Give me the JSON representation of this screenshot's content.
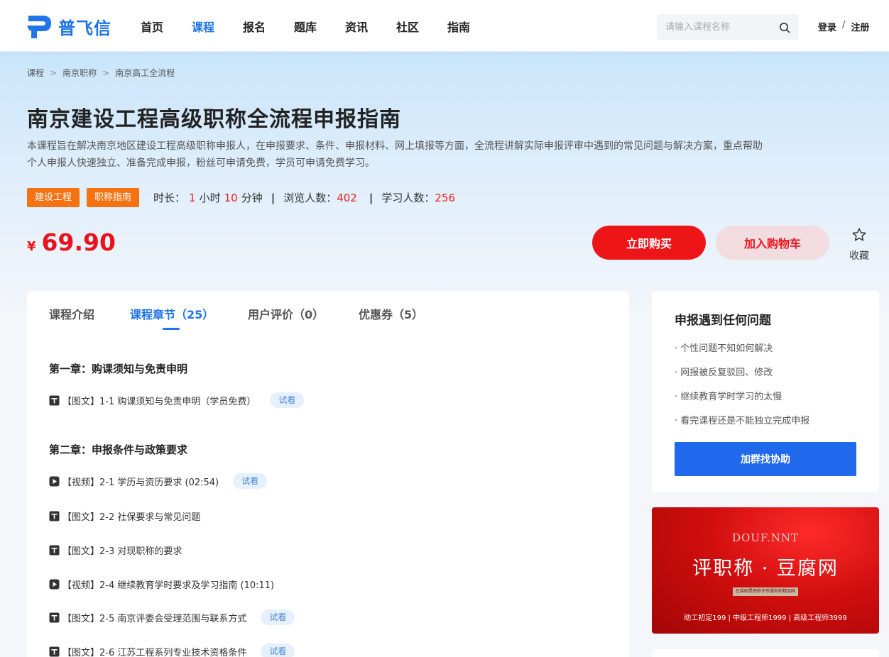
{
  "header": {
    "brand": "普飞信",
    "nav": [
      "首页",
      "课程",
      "报名",
      "题库",
      "资讯",
      "社区",
      "指南"
    ],
    "active_nav": "课程",
    "search_placeholder": "请输入课程名称",
    "login": "登录",
    "separator": "/",
    "register": "注册",
    "brand_color": "#1f74e8"
  },
  "breadcrumb": [
    "课程",
    "南京职称",
    "南京高工全流程"
  ],
  "course": {
    "title": "南京建设工程高级职称全流程申报指南",
    "description": "本课程旨在解决南京地区建设工程高级职称申报人，在申报要求、条件、申报材料、网上填报等方面，全流程讲解实际申报评审中遇到的常见问题与解决方案，重点帮助个人申报人快速独立、准备完成申报，粉丝可申请免费，学员可申请免费学习。",
    "tags": [
      "建设工程",
      "职称指南"
    ],
    "duration_label": "时长：",
    "duration_hours": "1",
    "hours_unit": "小时",
    "duration_minutes": "10",
    "minutes_unit": "分钟",
    "views_label": "浏览人数：",
    "views": "402",
    "learners_label": "学习人数：",
    "learners": "256",
    "currency": "¥",
    "price": "69.90",
    "buy_label": "立即购买",
    "cart_label": "加入购物车",
    "favorite_label": "收藏"
  },
  "tabs": [
    "课程介绍",
    "课程章节（25）",
    "用户评价（0）",
    "优惠券（5）"
  ],
  "active_tab": "课程章节（25）",
  "chapters": [
    {
      "title": "第一章：购课须知与免责申明",
      "lessons": [
        {
          "type": "doc",
          "text": "【图文】1-1 购课须知与免责申明（学员免费）",
          "trial": "试看"
        }
      ]
    },
    {
      "title": "第二章：申报条件与政策要求",
      "lessons": [
        {
          "type": "video",
          "text": "【视频】2-1 学历与资历要求 (02:54)",
          "trial": "试看"
        },
        {
          "type": "doc",
          "text": "【图文】2-2 社保要求与常见问题",
          "trial": ""
        },
        {
          "type": "doc",
          "text": "【图文】2-3 对现职称的要求",
          "trial": ""
        },
        {
          "type": "video",
          "text": "【视频】2-4 继续教育学时要求及学习指南 (10:11)",
          "trial": ""
        },
        {
          "type": "doc",
          "text": "【图文】2-5 南京评委会受理范围与联系方式",
          "trial": "试看"
        },
        {
          "type": "doc",
          "text": "【图文】2-6 江苏工程系列专业技术资格条件",
          "trial": "试看"
        }
      ]
    }
  ],
  "sidebar": {
    "title": "申报遇到任何问题",
    "items": [
      "· 个性问题不知如何解决",
      "· 网报被反复驳回、修改",
      "· 继续教育学时学习的太慢",
      "· 看完课程还是不能独立完成申报"
    ],
    "button": "加群找协助"
  },
  "banner": {
    "en": "DOUF.NNT",
    "title": "评职称 · 豆腐网",
    "small": "豆腐网是职称评审服务和精品网",
    "prices": "助工初定199 | 中级工程师1999 | 高级工程师3999"
  }
}
